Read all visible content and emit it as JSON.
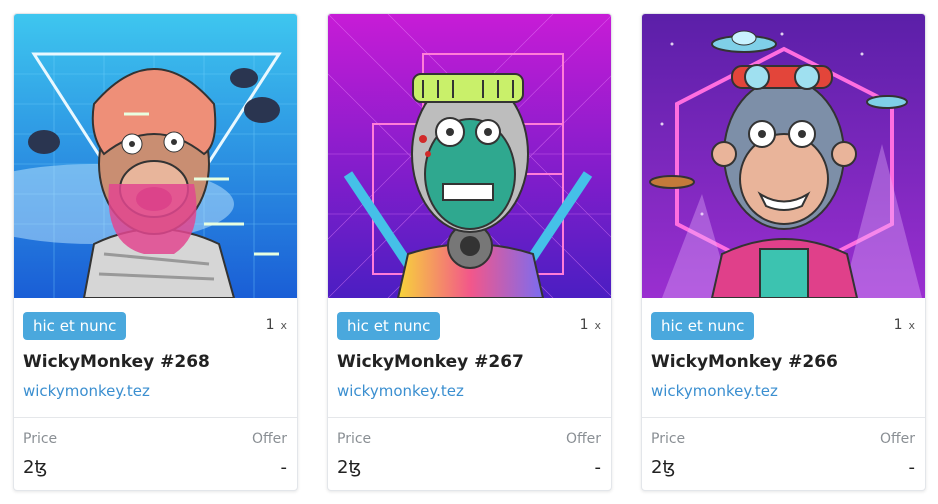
{
  "cards": [
    {
      "badge": "hic et nunc",
      "quantity": "1",
      "quantity_suffix": "x",
      "title": "WickyMonkey #268",
      "creator": "wickymonkey.tez",
      "price_label": "Price",
      "offer_label": "Offer",
      "price": "2ꜩ",
      "offer": "-"
    },
    {
      "badge": "hic et nunc",
      "quantity": "1",
      "quantity_suffix": "x",
      "title": "WickyMonkey #267",
      "creator": "wickymonkey.tez",
      "price_label": "Price",
      "offer_label": "Offer",
      "price": "2ꜩ",
      "offer": "-"
    },
    {
      "badge": "hic et nunc",
      "quantity": "1",
      "quantity_suffix": "x",
      "title": "WickyMonkey #266",
      "creator": "wickymonkey.tez",
      "price_label": "Price",
      "offer_label": "Offer",
      "price": "2ꜩ",
      "offer": "-"
    }
  ],
  "colors": {
    "badge": "#4aa8dd",
    "creator_link": "#3b8fd0",
    "border": "#e3e6ea"
  }
}
